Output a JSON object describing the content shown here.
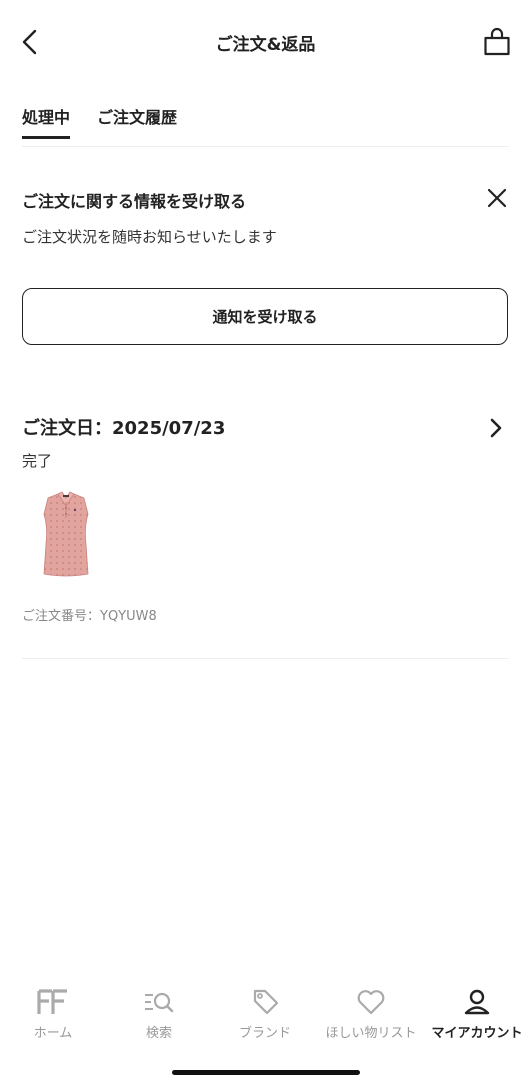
{
  "header": {
    "title": "ご注文&返品",
    "back_icon": "chevron-left-icon",
    "bag_icon": "shopping-bag-icon"
  },
  "tabs": [
    {
      "label": "処理中",
      "active": true
    },
    {
      "label": "ご注文履歴",
      "active": false
    }
  ],
  "notification": {
    "title": "ご注文に関する情報を受け取る",
    "description": "ご注文状況を随時お知らせいたします",
    "button_label": "通知を受け取る",
    "close_icon": "close-icon"
  },
  "order": {
    "date_label": "ご注文日：2025/07/23",
    "status": "完了",
    "order_number_label": "ご注文番号：YQYUW8",
    "product_image": "pink-sleeveless-polo-shirt",
    "product_color": "#e0a19b",
    "chevron_icon": "chevron-right-icon"
  },
  "bottom_nav": [
    {
      "label": "ホーム",
      "icon": "ff-logo-icon",
      "active": false
    },
    {
      "label": "検索",
      "icon": "search-icon",
      "active": false
    },
    {
      "label": "ブランド",
      "icon": "tag-icon",
      "active": false
    },
    {
      "label": "ほしい物リスト",
      "icon": "heart-icon",
      "active": false
    },
    {
      "label": "マイアカウント",
      "icon": "account-icon",
      "active": true
    }
  ]
}
